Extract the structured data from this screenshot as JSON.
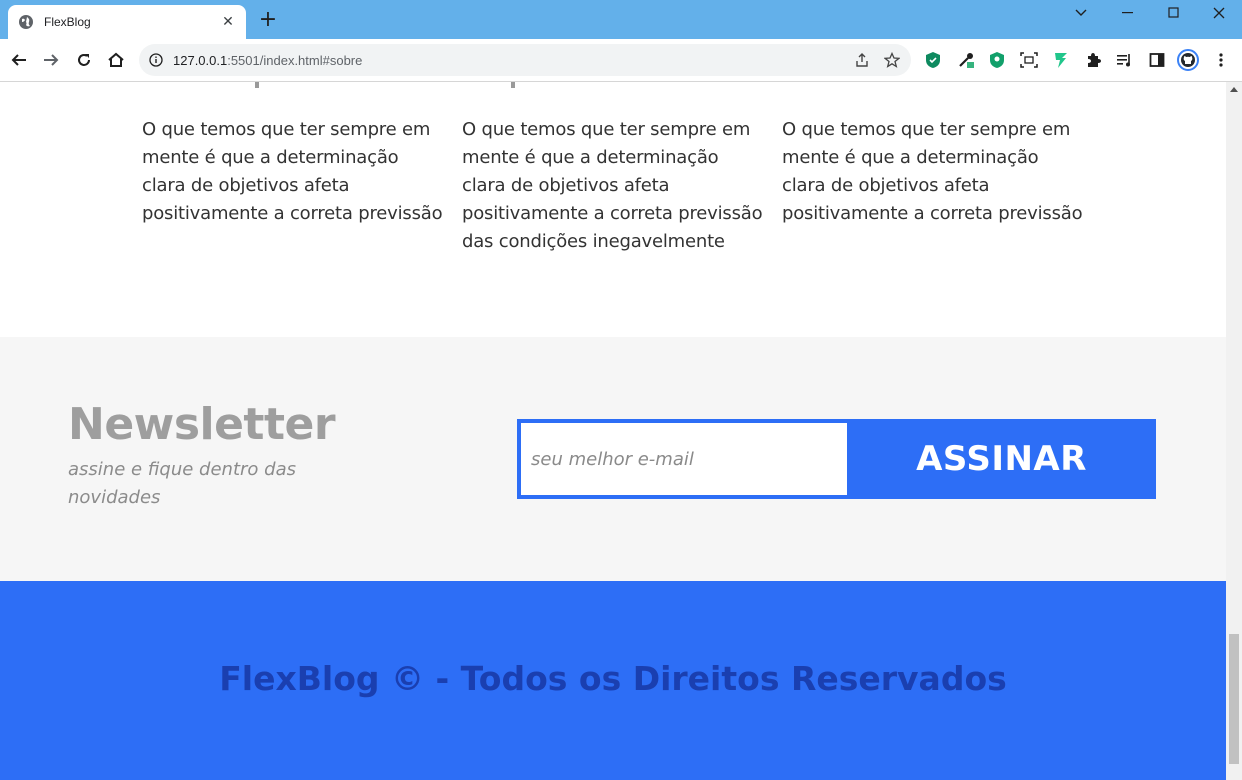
{
  "browser": {
    "tab_title": "FlexBlog",
    "url_host": "127.0.0.1",
    "url_rest": ":5501/index.html#sobre",
    "new_tab_symbol": "+",
    "close_symbol": "✕"
  },
  "columns": [
    {
      "text": "O que temos que ter sempre em mente é que a determinação clara de objetivos afeta positivamente a correta previssão"
    },
    {
      "text": "O que temos que ter sempre em mente é que a determinação clara de objetivos afeta positivamente a correta previssão das condições inegavelmente"
    },
    {
      "text": "O que temos que ter sempre em mente é que a determinação clara de objetivos afeta positivamente a correta previssão"
    }
  ],
  "newsletter": {
    "title": "Newsletter",
    "subtitle": "assine e fique dentro das novidades",
    "email_placeholder": "seu melhor e-mail",
    "email_value": "",
    "button_label": "ASSINAR"
  },
  "footer": {
    "text": "FlexBlog © - Todos os Direitos Reservados"
  },
  "colors": {
    "titlebar": "#63b0ea",
    "primary": "#2d6ef6",
    "footer_text": "#1a3fb0",
    "newsletter_bg": "#f6f6f6"
  }
}
